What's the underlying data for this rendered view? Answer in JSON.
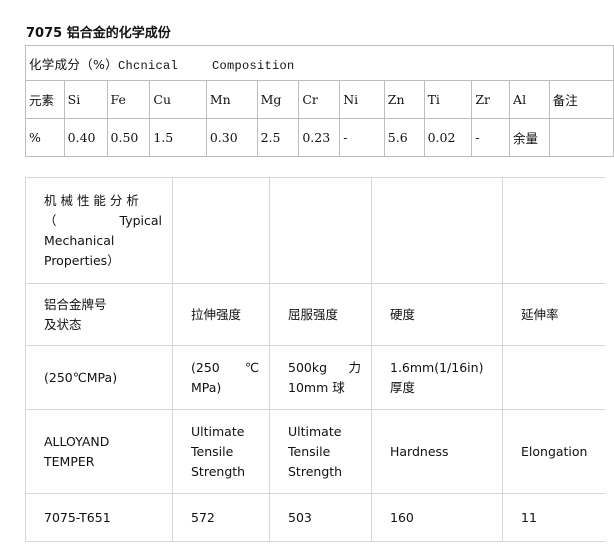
{
  "title": "7075 铝合金的化学成份",
  "composition": {
    "caption_zh": "化学成分（%）",
    "caption_en1": "Chcnical",
    "caption_en2": "Composition",
    "headers": [
      "元素",
      "Si",
      "Fe",
      "Cu",
      "Mn",
      "Mg",
      "Cr",
      "Ni",
      "Zn",
      "Ti",
      "Zr",
      "Al",
      "备注"
    ],
    "values": [
      "%",
      "0.40",
      "0.50",
      "1.5",
      "0.30",
      "2.5",
      "0.23",
      "-",
      "5.6",
      "0.02",
      "-",
      "余量",
      ""
    ]
  },
  "mechanical": {
    "heading_line1": "机 械 性 能 分 析",
    "heading_line2_a": "（",
    "heading_line2_b": "Typical",
    "heading_line3": "Mechanical",
    "heading_line4": "Properties）",
    "row_zh": {
      "c1_l1": "铝合金牌号",
      "c1_l2": "及状态",
      "c2": "拉伸强度",
      "c3": "屈服强度",
      "c4": "硬度",
      "c5": "延伸率"
    },
    "row_units": {
      "c1": "(250℃MPa)",
      "c2_l1a": "(250",
      "c2_l1b": "℃",
      "c2_l2": "MPa)",
      "c3_l1a": "500kg",
      "c3_l1b": "力",
      "c3_l2": "10mm 球",
      "c4_l1": "1.6mm(1/16in)",
      "c4_l2": "厚度",
      "c5": ""
    },
    "row_en": {
      "c1": "ALLOYAND TEMPER",
      "c2_l1": "Ultimate",
      "c2_l2": "Tensile",
      "c2_l3": "Strength",
      "c3_l1": "Ultimate",
      "c3_l2": "Tensile",
      "c3_l3": "Strength",
      "c4": "Hardness",
      "c5": "Elongation"
    },
    "row_vals": {
      "c1": "7075-T651",
      "c2": "572",
      "c3": "503",
      "c4": "160",
      "c5": "11"
    }
  }
}
